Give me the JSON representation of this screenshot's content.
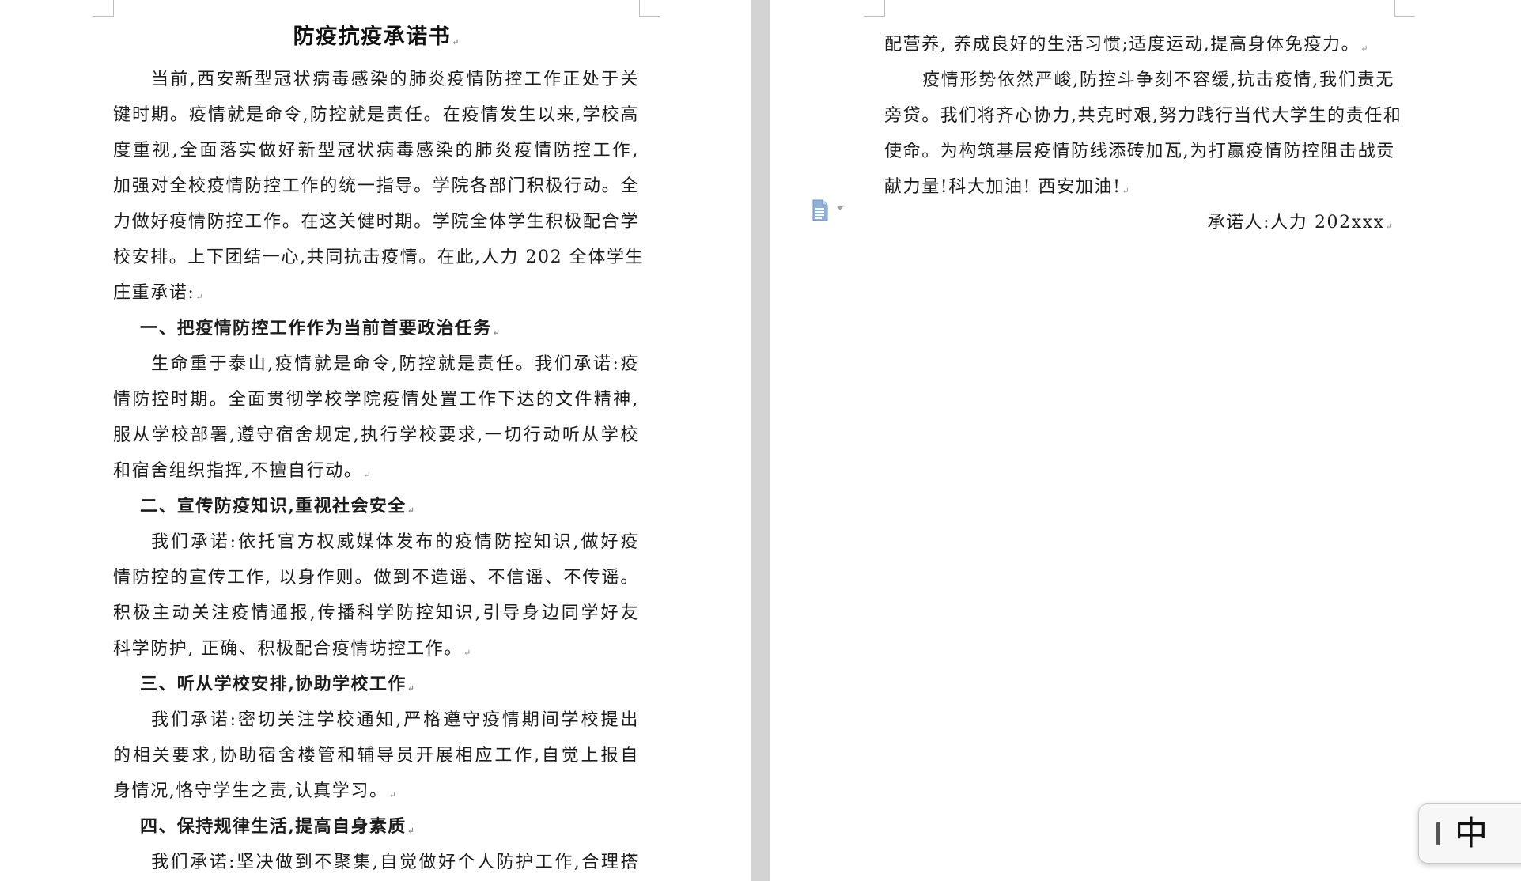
{
  "document": {
    "title": "防疫抗疫承诺书",
    "paragraph_mark": "↵",
    "page1_lines": [
      {
        "text": "当前,西安新型冠状病毒感染的肺炎疫情防控工作正处于关",
        "kind": "first"
      },
      {
        "text": "键时期。疫情就是命令,防控就是责任。在疫情发生以来,学校高",
        "kind": "body"
      },
      {
        "text": "度重视,全面落实做好新型冠状病毒感染的肺炎疫情防控工作,",
        "kind": "body"
      },
      {
        "text": "加强对全校疫情防控工作的统一指导。学院各部门积极行动。全",
        "kind": "body"
      },
      {
        "text": "力做好疫情防控工作。在这关健时期。学院全体学生积极配合学",
        "kind": "body"
      },
      {
        "text": "校安排。上下团结一心,共同抗击疫情。在此,人力 202 全体学生",
        "kind": "body"
      },
      {
        "text": "庄重承诺:",
        "kind": "last"
      },
      {
        "text": "一、把疫情防控工作作为当前首要政治任务",
        "kind": "heading"
      },
      {
        "text": "生命重于泰山,疫情就是命令,防控就是责任。我们承诺:疫",
        "kind": "first"
      },
      {
        "text": "情防控时期。全面贯彻学校学院疫情处置工作下达的文件精神,",
        "kind": "body"
      },
      {
        "text": "服从学校部署,遵守宿舍规定,执行学校要求,一切行动听从学校",
        "kind": "body"
      },
      {
        "text": "和宿舍组织指挥,不擅自行动。",
        "kind": "last"
      },
      {
        "text": "二、宣传防疫知识,重视社会安全",
        "kind": "heading"
      },
      {
        "text": "我们承诺:依托官方权威媒体发布的疫情防控知识,做好疫",
        "kind": "first"
      },
      {
        "text": "情防控的宣传工作, 以身作则。做到不造谣、不信谣、不传谣。",
        "kind": "body"
      },
      {
        "text": "积极主动关注疫情通报,传播科学防控知识,引导身边同学好友",
        "kind": "body"
      },
      {
        "text": "科学防护, 正确、积极配合疫情坊控工作。",
        "kind": "last"
      },
      {
        "text": "三、听从学校安排,协助学校工作",
        "kind": "heading"
      },
      {
        "text": "我们承诺:密切关注学校通知,严格遵守疫情期间学校提出",
        "kind": "first"
      },
      {
        "text": "的相关要求,协助宿舍楼管和辅导员开展相应工作,自觉上报自",
        "kind": "body"
      },
      {
        "text": "身情况,恪守学生之责,认真学习。",
        "kind": "last"
      },
      {
        "text": "四、保持规律生活,提高自身素质",
        "kind": "heading"
      },
      {
        "text": "我们承诺:坚决做到不聚集,自觉做好个人防护工作,合理搭",
        "kind": "first"
      }
    ],
    "page2_lines": [
      {
        "text": "配营养, 养成良好的生活习惯;适度运动,提高身体免疫力。",
        "kind": "last"
      },
      {
        "text": "疫情形势依然严峻,防控斗争刻不容缓,抗击疫情,我们责无",
        "kind": "first"
      },
      {
        "text": "旁贷。我们将齐心协力,共克时艰,努力践行当代大学生的责任和",
        "kind": "body"
      },
      {
        "text": "使命。为构筑基层疫情防线添砖加瓦,为打赢疫情防控阻击战贡",
        "kind": "body"
      },
      {
        "text": "献力量!科大加油! 西安加油!",
        "kind": "last"
      }
    ],
    "signature": "承诺人:人力 202xxx"
  },
  "ime": {
    "label": "中"
  },
  "paste_options": {
    "icon": "paste-options-icon"
  }
}
